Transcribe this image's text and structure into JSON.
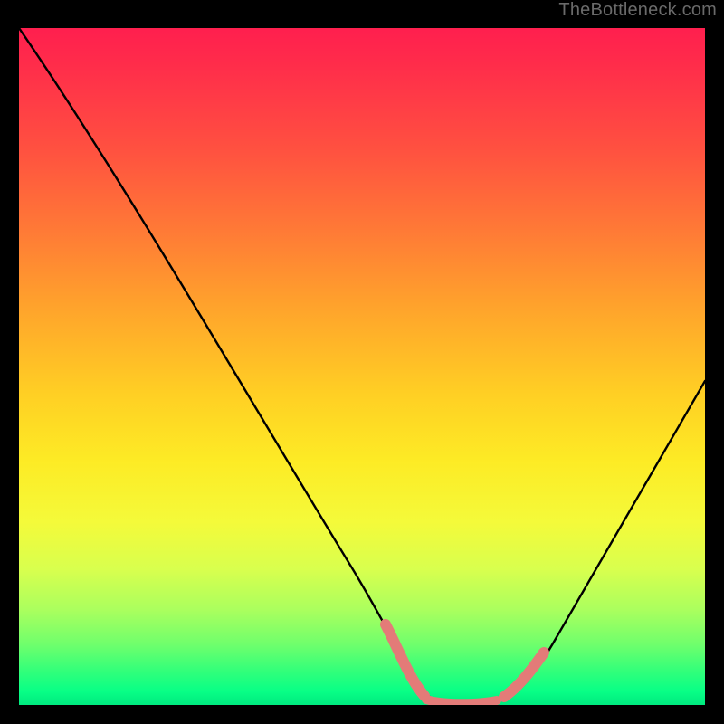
{
  "credit": "TheBottleneck.com",
  "colors": {
    "curve": "#000000",
    "highlight": "#e37b78",
    "gradient_top": "#ff1f4e",
    "gradient_bottom": "#00e97f"
  },
  "chart_data": {
    "type": "line",
    "title": "",
    "xlabel": "",
    "ylabel": "",
    "xlim": [
      0,
      100
    ],
    "ylim": [
      0,
      100
    ],
    "x": [
      0,
      5,
      10,
      15,
      20,
      25,
      30,
      35,
      40,
      45,
      50,
      55,
      58,
      60,
      62,
      65,
      68,
      70,
      72,
      75,
      80,
      85,
      90,
      95,
      100
    ],
    "y": [
      99,
      91,
      83,
      75,
      67,
      59,
      50,
      42,
      33,
      24,
      15,
      7,
      3,
      1,
      0,
      0,
      0,
      1,
      2,
      5,
      12,
      22,
      33,
      44,
      55
    ],
    "highlight_segment": {
      "x": [
        55,
        58,
        60,
        62,
        65,
        68,
        70,
        72,
        75
      ],
      "y": [
        7,
        3,
        1,
        0,
        0,
        0,
        1,
        2,
        5
      ]
    }
  }
}
